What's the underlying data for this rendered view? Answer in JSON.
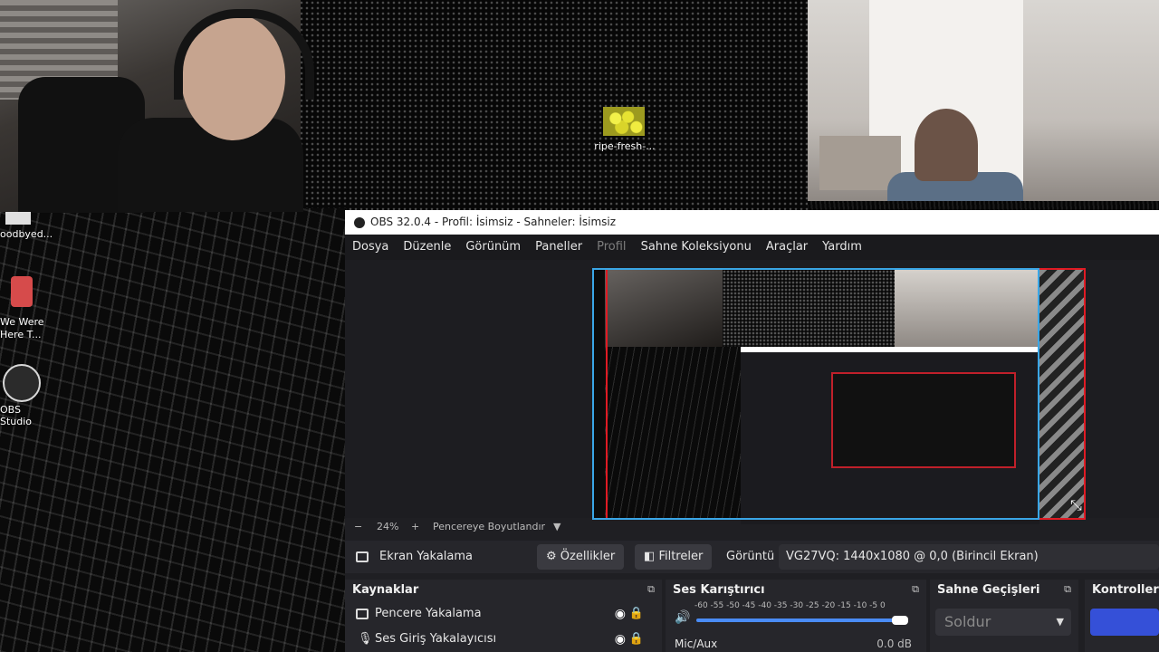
{
  "desktop": {
    "icons": [
      {
        "label": "ripe-fresh-...",
        "icon": "image-file-icon"
      },
      {
        "label": "oodbyed...",
        "icon": "app-icon"
      },
      {
        "label": "We Were Here T...",
        "icon": "game-icon"
      },
      {
        "label": "OBS Studio",
        "icon": "obs-icon"
      }
    ]
  },
  "obs": {
    "title": "OBS 32.0.4 - Profil: İsimsiz - Sahneler: İsimsiz",
    "menu": [
      "Dosya",
      "Düzenle",
      "Görünüm",
      "Paneller",
      "Profil",
      "Sahne Koleksiyonu",
      "Araçlar",
      "Yardım"
    ],
    "zoom": {
      "minus": "−",
      "value": "24%",
      "plus": "+",
      "fit_label": "Pencereye Boyutlandır"
    },
    "source_bar": {
      "source_name": "Ekran Yakalama",
      "properties_label": "Özellikler",
      "filters_label": "Filtreler",
      "display_label": "Görüntü",
      "display_value": "VG27VQ: 1440x1080 @ 0,0 (Birincil Ekran)"
    },
    "docks": {
      "sources": {
        "title": "Kaynaklar",
        "items": [
          {
            "label": "Pencere Yakalama",
            "icon": "window-icon"
          },
          {
            "label": "Ses Giriş Yakalayıcısı",
            "icon": "microphone-icon"
          }
        ]
      },
      "mixer": {
        "title": "Ses Karıştırıcı",
        "ticks": "-60 -55 -50 -45 -40 -35 -30 -25 -20 -15 -10 -5 0",
        "channel_label": "Mic/Aux",
        "channel_level": "0.0 dB"
      },
      "transitions": {
        "title": "Sahne Geçişleri",
        "selected": "Soldur"
      },
      "controls": {
        "title": "Kontroller"
      }
    }
  }
}
